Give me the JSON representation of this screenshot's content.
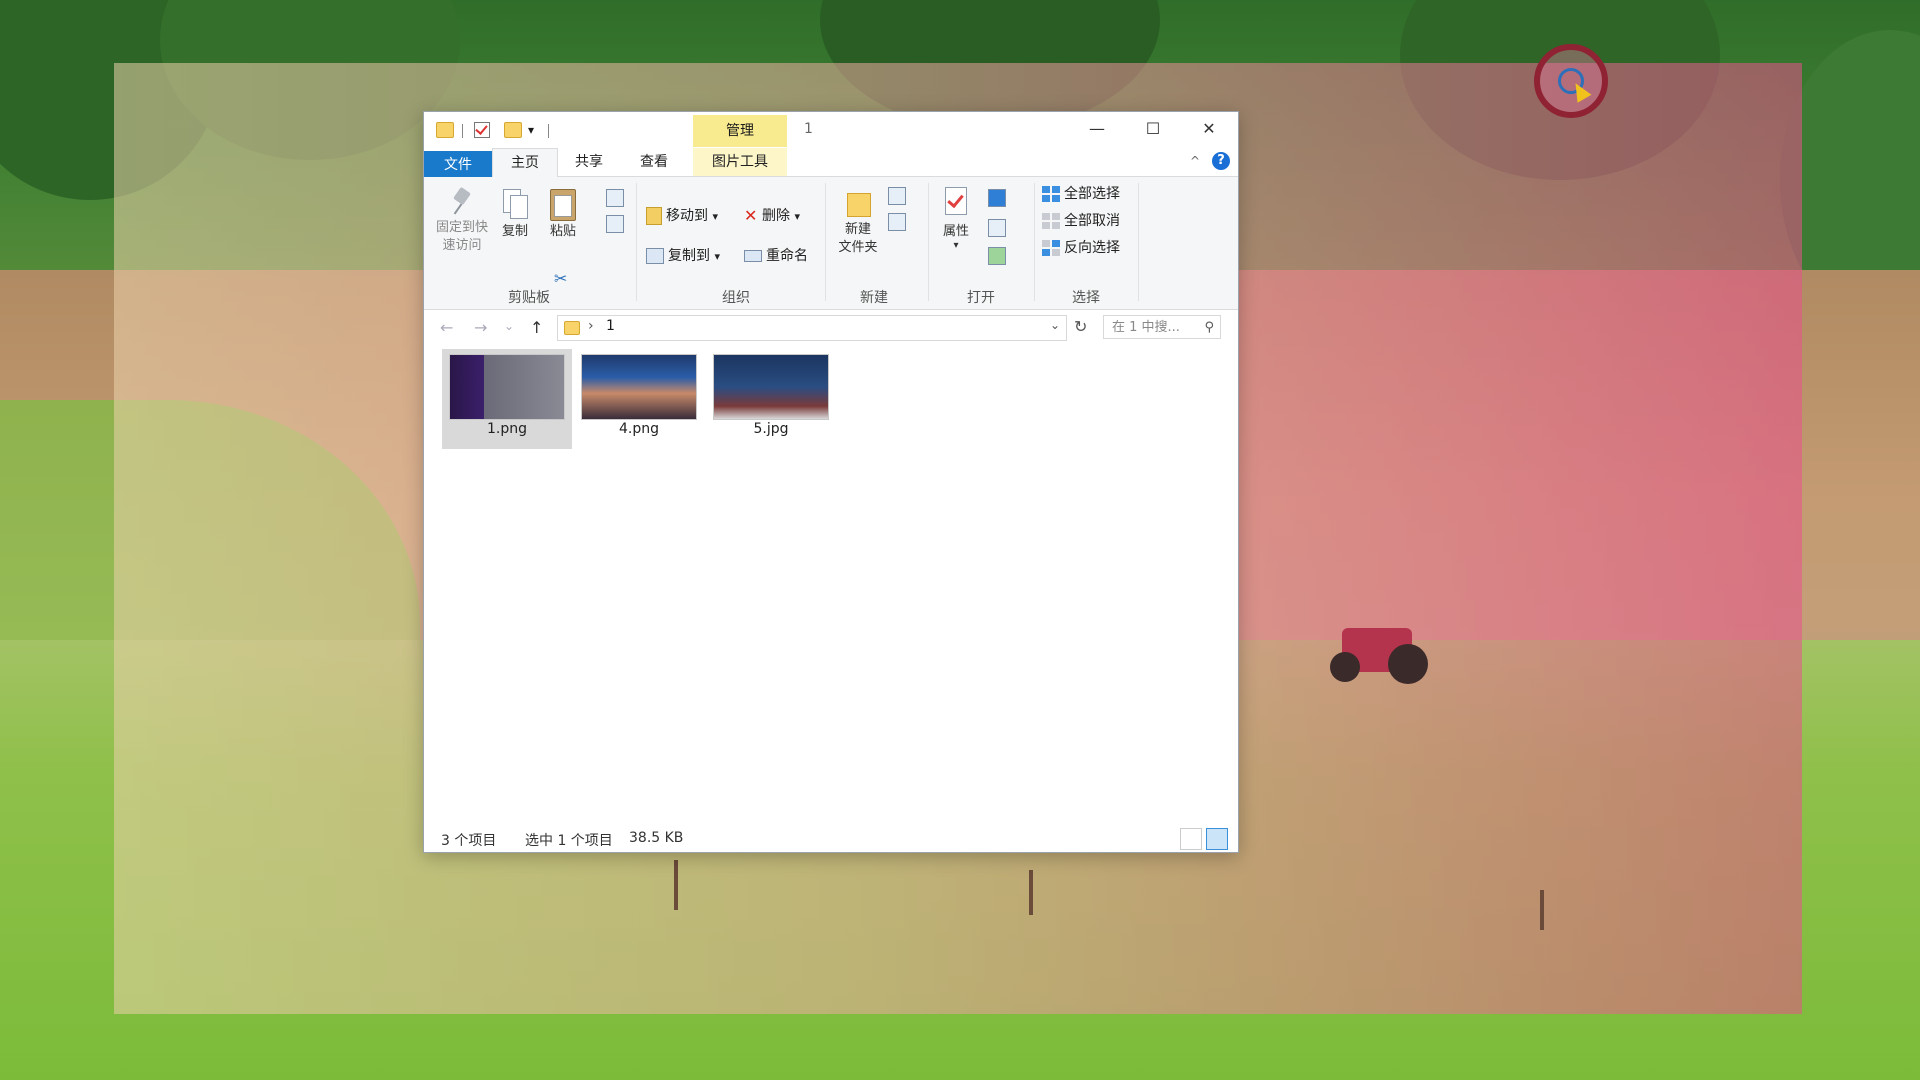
{
  "window": {
    "quick_access_dropdown": "▾",
    "manage_tab": "管理",
    "title": "1",
    "controls": {
      "minimize": "—",
      "maximize": "☐",
      "close": "✕"
    }
  },
  "tabs": {
    "file": "文件",
    "home": "主页",
    "share": "共享",
    "view": "查看",
    "picture_tools": "图片工具",
    "collapse": "^",
    "help": "?"
  },
  "ribbon": {
    "clipboard": {
      "pin_label_1": "固定到快",
      "pin_label_2": "速访问",
      "copy": "复制",
      "paste": "粘贴",
      "cut": "✂",
      "group": "剪贴板"
    },
    "organize": {
      "move_to": "移动到",
      "copy_to": "复制到",
      "delete": "删除",
      "rename": "重命名",
      "dropdown": "▾",
      "group": "组织"
    },
    "new": {
      "new_folder_1": "新建",
      "new_folder_2": "文件夹",
      "group": "新建"
    },
    "open": {
      "properties": "属性",
      "dropdown": "▾",
      "group": "打开"
    },
    "select": {
      "select_all": "全部选择",
      "select_none": "全部取消",
      "invert": "反向选择",
      "group": "选择"
    }
  },
  "address": {
    "back": "←",
    "forward": "→",
    "recent": "⌄",
    "up": "↑",
    "separator": "›",
    "path": "1",
    "dropdown": "⌄",
    "refresh": "↻",
    "search_placeholder": "在 1 中搜...",
    "search_icon": "⚲"
  },
  "files": [
    {
      "name": "1.png",
      "selected": true
    },
    {
      "name": "4.png",
      "selected": false
    },
    {
      "name": "5.jpg",
      "selected": false
    }
  ],
  "status": {
    "count": "3 个项目",
    "selected": "选中 1 个项目",
    "size": "38.5 KB"
  },
  "colors": {
    "file_tab": "#1979ca",
    "manage_tab": "#f8ea8f",
    "selection": "#d9d9d9",
    "overlay_tint": "#e8508c"
  }
}
